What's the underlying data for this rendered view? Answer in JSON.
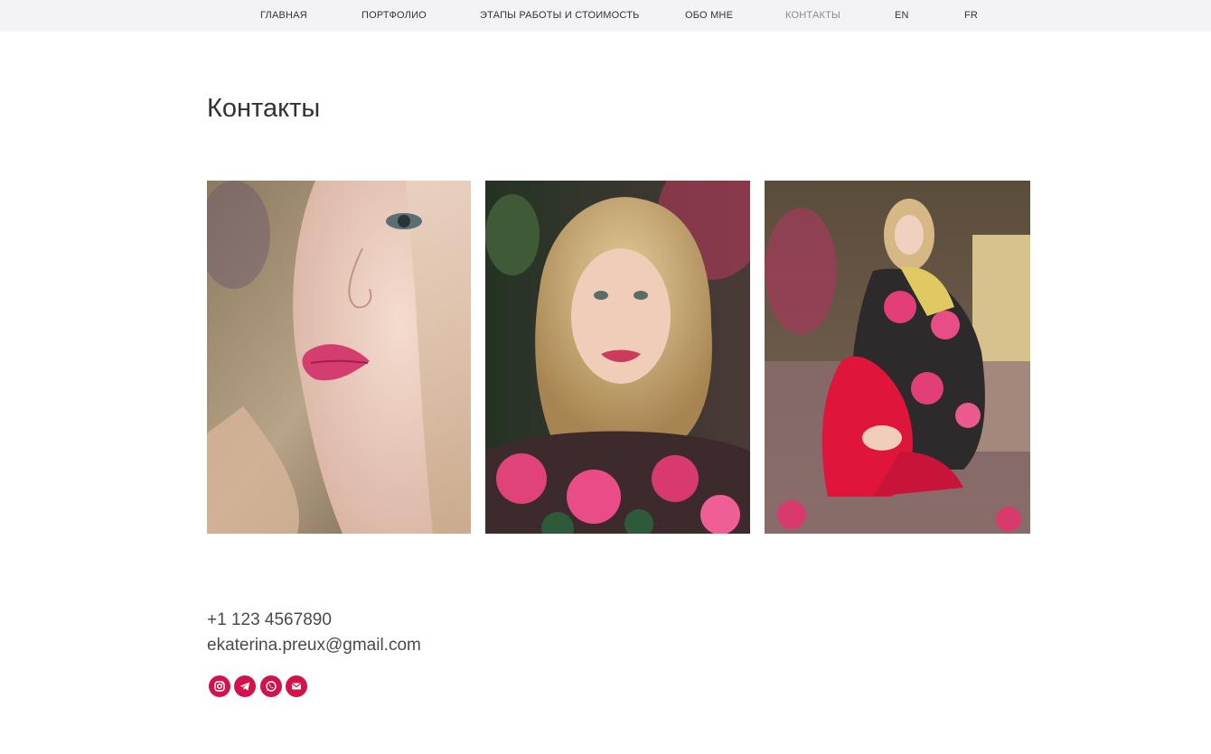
{
  "nav": {
    "items": [
      {
        "label": "ГЛАВНАЯ"
      },
      {
        "label": "ПОРТФОЛИО"
      },
      {
        "label": "ЭТАПЫ РАБОТЫ И СТОИМОСТЬ"
      },
      {
        "label": "ОБО МНЕ"
      },
      {
        "label": "КОНТАКТЫ"
      },
      {
        "label": "EN"
      },
      {
        "label": "FR"
      }
    ],
    "active_label": "КОНТАКТЫ"
  },
  "page": {
    "title": "Контакты"
  },
  "gallery": {
    "photos": [
      {
        "icon": "portrait-closeup-profile"
      },
      {
        "icon": "portrait-floral-dress"
      },
      {
        "icon": "full-figure-red-tights"
      }
    ]
  },
  "contacts": {
    "phone": "+1 123 4567890",
    "email": "ekaterina.preux@gmail.com"
  },
  "social": {
    "accent_color": "#d3114b",
    "icons": [
      "instagram-icon",
      "telegram-icon",
      "whatsapp-icon",
      "email-icon"
    ]
  }
}
